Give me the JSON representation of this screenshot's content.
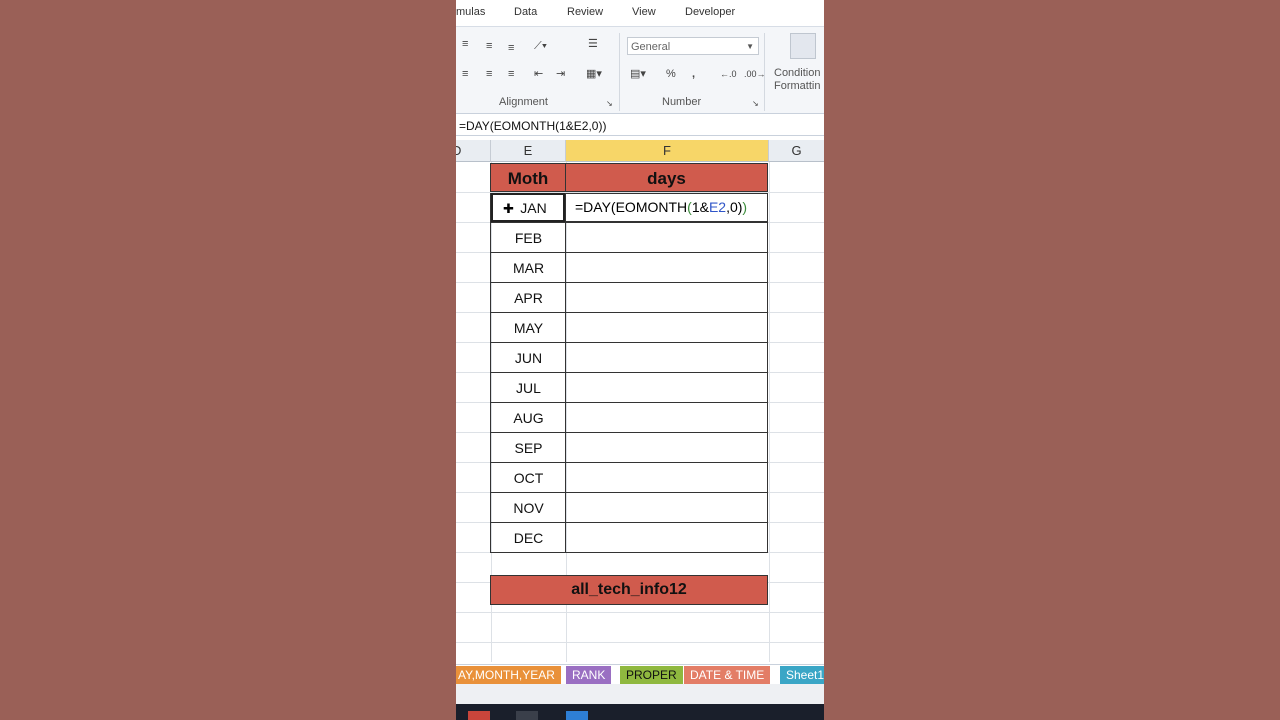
{
  "ribbon": {
    "tabs": [
      "mulas",
      "Data",
      "Review",
      "View",
      "Developer"
    ],
    "alignment_label": "Alignment",
    "number_label": "Number",
    "number_format": "General",
    "percent": "%",
    "comma": ",",
    "cond_label_1": "Condition",
    "cond_label_2": "Formattin"
  },
  "formula_bar": {
    "content": "=DAY(EOMONTH(1&E2,0))"
  },
  "columns": {
    "d": "D",
    "e": "E",
    "f": "F",
    "g": "G"
  },
  "table": {
    "header_month": "Moth",
    "header_days": "days",
    "months": [
      "JAN",
      "FEB",
      "MAR",
      "APR",
      "MAY",
      "JUN",
      "JUL",
      "AUG",
      "SEP",
      "OCT",
      "NOV",
      "DEC"
    ]
  },
  "editing": {
    "prefix": "=DAY(EOMONTH",
    "open": "(",
    "mid": "1&",
    "ref": "E2",
    "tail": ",0)",
    "close": ")"
  },
  "banner": "all_tech_info12",
  "sheet_tabs": [
    {
      "label": "AY,MONTH,YEAR",
      "color": "#e9913a"
    },
    {
      "label": "RANK",
      "color": "#9a6fc2"
    },
    {
      "label": "PROPER",
      "color": "#8fb83f"
    },
    {
      "label": "DATE & TIME",
      "color": "#e37d66"
    },
    {
      "label": "Sheet1",
      "color": "#3aa6c6"
    }
  ],
  "colors": {
    "header_fill": "#d05b4d",
    "selected_column": "#f7d668",
    "background": "#9a6057"
  }
}
